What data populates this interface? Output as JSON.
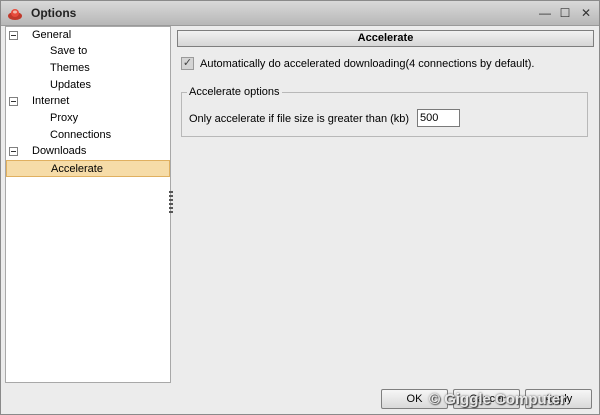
{
  "window": {
    "title": "Options",
    "controls": {
      "minimize": "—",
      "maximize": "☐",
      "close": "✕"
    }
  },
  "tree": {
    "categories": [
      {
        "label": "General",
        "children": [
          "Save to",
          "Themes",
          "Updates"
        ]
      },
      {
        "label": "Internet",
        "children": [
          "Proxy",
          "Connections"
        ]
      },
      {
        "label": "Downloads",
        "children": [
          "Accelerate"
        ]
      }
    ],
    "selected": "Accelerate"
  },
  "panel": {
    "header": "Accelerate",
    "checkbox_label": "Automatically do accelerated downloading(4 connections by default).",
    "checkbox_checked": true,
    "checkbox_glyph": "✓",
    "group_title": "Accelerate options",
    "size_label": "Only accelerate if file size is greater than (kb)",
    "size_value": "500"
  },
  "buttons": {
    "ok": "OK",
    "cancel": "Cancel",
    "apply": "Apply"
  },
  "watermark": "© Giggle Computer",
  "colors": {
    "selected_bg": "#f6dca8",
    "app_icon": "#c0392b"
  },
  "icons": {
    "app": "app-icon",
    "expander": "collapse-icon"
  }
}
